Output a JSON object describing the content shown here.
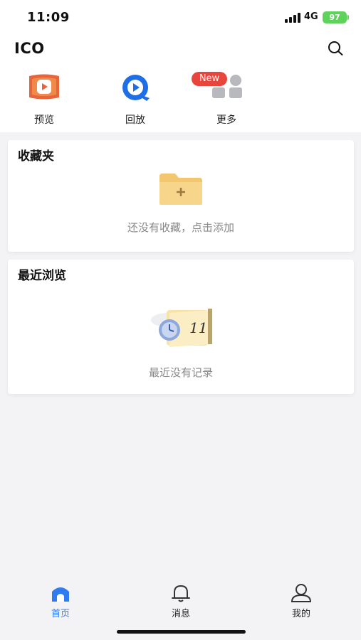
{
  "status_bar": {
    "time": "11:09",
    "network": "4G",
    "battery": "97"
  },
  "header": {
    "title": "ICO",
    "search_icon": "search-icon"
  },
  "quick_actions": [
    {
      "label": "预览",
      "icon": "preview-play-icon"
    },
    {
      "label": "回放",
      "icon": "playback-icon"
    },
    {
      "label": "更多",
      "icon": "more-grid-icon",
      "badge": "New"
    }
  ],
  "favorites": {
    "title": "收藏夹",
    "empty_text": "还没有收藏，点击添加",
    "icon": "folder-add-icon"
  },
  "recent": {
    "title": "最近浏览",
    "empty_text": "最近没有记录",
    "icon": "calendar-clock-icon"
  },
  "tab_bar": [
    {
      "label": "首页",
      "icon": "home-icon",
      "active": true
    },
    {
      "label": "消息",
      "icon": "bell-icon",
      "active": false
    },
    {
      "label": "我的",
      "icon": "user-icon",
      "active": false
    }
  ],
  "colors": {
    "accent": "#2f7bf0",
    "badge": "#e8453c",
    "battery": "#5fd25b",
    "preview_icon": "#e8643a"
  }
}
